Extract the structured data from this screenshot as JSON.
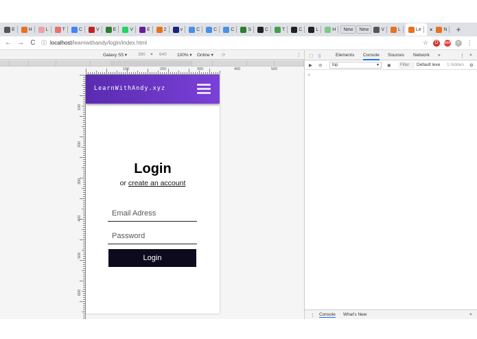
{
  "browser": {
    "tabs": [
      {
        "label": "E",
        "color": "#555555"
      },
      {
        "label": "H",
        "color": "#e8711c"
      },
      {
        "label": "L",
        "color": "#f0a0a0"
      },
      {
        "label": "T",
        "color": "#e87070"
      },
      {
        "label": "C",
        "color": "#4285f4"
      },
      {
        "label": "V",
        "color": "#c5221f"
      },
      {
        "label": "E",
        "color": "#2e7d32"
      },
      {
        "label": "V",
        "color": "#25d366"
      },
      {
        "label": "E",
        "color": "#6a1b9a"
      },
      {
        "label": "2",
        "color": "#e8711c"
      },
      {
        "label": "v",
        "color": "#1a237e"
      },
      {
        "label": "C",
        "color": "#4a90e2"
      },
      {
        "label": "C",
        "color": "#4a90e2"
      },
      {
        "label": "C",
        "color": "#4a90e2"
      },
      {
        "label": "S",
        "color": "#2e7d32"
      },
      {
        "label": "C",
        "color": "#222222"
      },
      {
        "label": "T",
        "color": "#43a047"
      },
      {
        "label": "C",
        "color": "#222222"
      },
      {
        "label": "L",
        "color": "#222222"
      },
      {
        "label": "H",
        "color": "#81c784"
      }
    ],
    "new_tab_1": "New",
    "new_tab_2": "New",
    "trailing_tabs": [
      {
        "label": "V",
        "color": "#555555"
      },
      {
        "label": "L",
        "color": "#e8711c"
      }
    ],
    "active_tab": {
      "label": "Le",
      "color": "#ffffff"
    },
    "after_active": {
      "label": "N",
      "color": "#e8711c"
    },
    "new_tab_button": "+",
    "url_host": "localhost",
    "url_path": "/learnwithandy/login/index.html",
    "nav": {
      "back": "←",
      "forward": "→",
      "reload": "C"
    }
  },
  "device_toolbar": {
    "device": "Galaxy S5 ▾",
    "width": "360",
    "times": "×",
    "height": "640",
    "zoom": "100% ▾",
    "network": "Online ▾"
  },
  "rulers": {
    "h_labels": [
      "100",
      "200",
      "300",
      "400",
      "500"
    ],
    "v_labels": [
      "100",
      "200",
      "300",
      "400",
      "500",
      "600"
    ]
  },
  "page": {
    "brand": "LearnWithAndy.xyz",
    "title": "Login",
    "sub_prefix": "or ",
    "sub_link": "create an account",
    "email_placeholder": "Email Adress",
    "password_placeholder": "Password",
    "login_button": "Login",
    "header_color": "#6a35c8",
    "button_color": "#0d0a1e"
  },
  "devtools": {
    "tabs": [
      "Elements",
      "Console",
      "Sources",
      "Network",
      "»"
    ],
    "active_tab": "Console",
    "context": "top",
    "filter_placeholder": "Filter",
    "levels": "Default leve",
    "hidden": "1 hidden",
    "prompt": "›",
    "drawer_tabs": [
      "Console",
      "What's New"
    ],
    "close": "×"
  }
}
